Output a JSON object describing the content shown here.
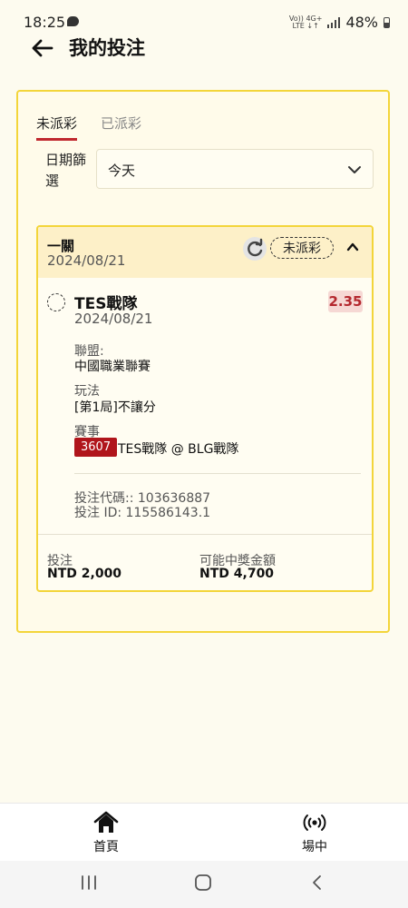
{
  "status_bar": {
    "time": "18:25",
    "network_top": "Vo)) 4G+",
    "network_bottom": "LTE ↓↑",
    "battery": "48%"
  },
  "header": {
    "title": "我的投注",
    "back_icon": "arrow-left-icon"
  },
  "tabs": [
    {
      "label": "未派彩",
      "active": true
    },
    {
      "label": "已派彩",
      "active": false
    }
  ],
  "filter": {
    "label": "日期篩選",
    "value": "今天"
  },
  "bet": {
    "title": "一關",
    "date": "2024/08/21",
    "status": "未派彩",
    "selection": {
      "team": "TES戰隊",
      "date": "2024/08/21",
      "odds": "2.35",
      "league_label": "聯盟:",
      "league": "中國職業聯賽",
      "market_label": "玩法",
      "market": "[第1局]不讓分",
      "event_label": "賽事",
      "event_id": "3607",
      "event_name": "TES戰隊 @ BLG戰隊"
    },
    "code_line": "投注代碼:: 103636887",
    "id_line": "投注 ID: 115586143.1",
    "stake_label": "投注",
    "stake_value": "NTD 2,000",
    "win_label": "可能中獎金額",
    "win_value": "NTD 4,700"
  },
  "bottom_nav": [
    {
      "label": "首頁",
      "icon": "home-icon"
    },
    {
      "label": "場中",
      "icon": "live-broadcast-icon"
    }
  ],
  "colors": {
    "accent_red": "#c0282e",
    "border_yellow": "#f3d53a",
    "event_badge": "#b0151b",
    "background": "#fdfbef"
  }
}
